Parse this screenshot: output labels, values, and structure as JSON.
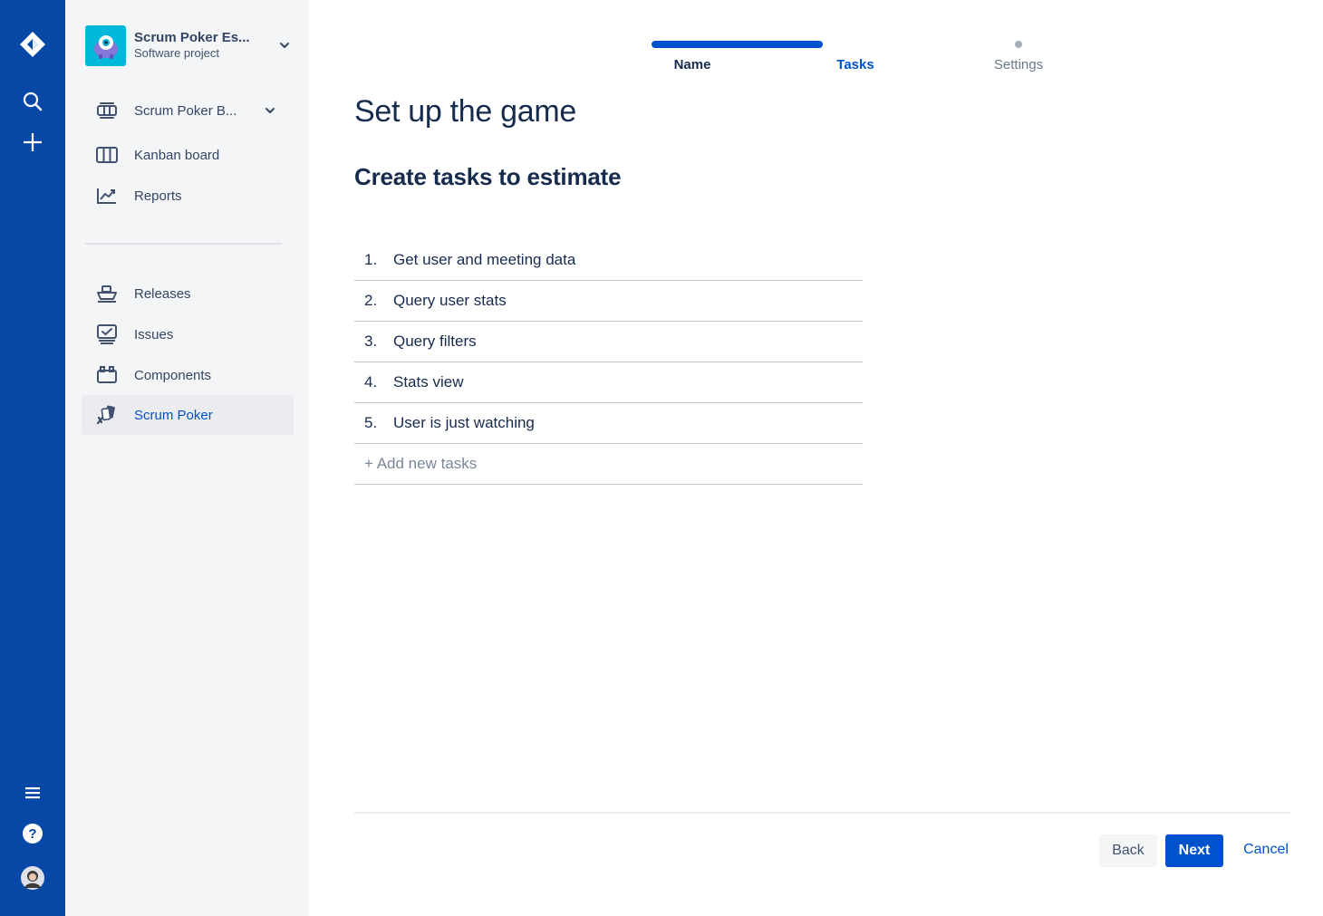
{
  "global_nav": {
    "logo_icon": "jira-logo-icon",
    "search_icon": "search-icon",
    "create_icon": "plus-icon",
    "menu_icon": "menu-icon",
    "help_icon": "help-icon",
    "profile_icon": "avatar",
    "bg_color": "#0747A6"
  },
  "project": {
    "name": "Scrum Poker Es...",
    "type": "Software project",
    "avatar_color": "#00B8D9"
  },
  "sidebar": {
    "board_switcher": {
      "label": "Scrum Poker B...",
      "icon": "board-icon"
    },
    "items_top": [
      {
        "label": "Kanban board",
        "icon": "kanban-icon"
      },
      {
        "label": "Reports",
        "icon": "reports-icon"
      }
    ],
    "items_bottom": [
      {
        "label": "Releases",
        "icon": "ship-icon"
      },
      {
        "label": "Issues",
        "icon": "issues-icon"
      },
      {
        "label": "Components",
        "icon": "components-icon"
      },
      {
        "label": "Scrum Poker",
        "icon": "scrum-poker-icon",
        "selected": true
      }
    ]
  },
  "wizard": {
    "steps": [
      {
        "label": "Name",
        "state": "complete"
      },
      {
        "label": "Tasks",
        "state": "current"
      },
      {
        "label": "Settings",
        "state": "upcoming"
      }
    ]
  },
  "main": {
    "title": "Set up the game",
    "section_title": "Create tasks to estimate",
    "tasks": [
      {
        "num": "1.",
        "label": "Get user and meeting data"
      },
      {
        "num": "2.",
        "label": "Query user stats"
      },
      {
        "num": "3.",
        "label": "Query filters"
      },
      {
        "num": "4.",
        "label": "Stats view"
      },
      {
        "num": "5.",
        "label": "User is just watching"
      }
    ],
    "add_placeholder": "+ Add new tasks"
  },
  "footer": {
    "back_label": "Back",
    "next_label": "Next",
    "cancel_label": "Cancel",
    "primary_color": "#0052CC"
  }
}
